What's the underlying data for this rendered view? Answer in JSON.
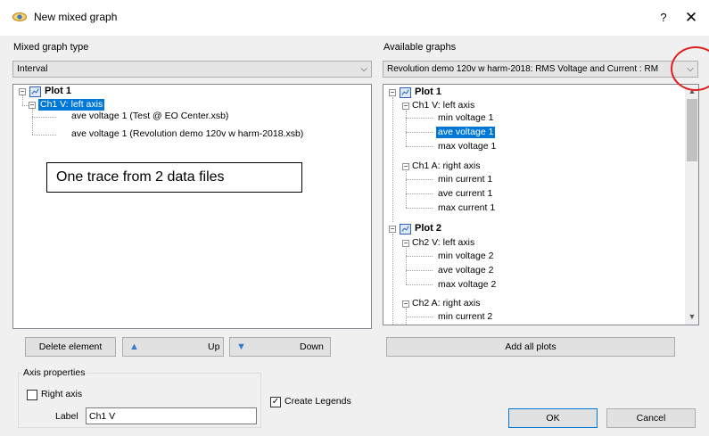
{
  "window": {
    "title": "New mixed graph",
    "help_label": "?",
    "close_label": "✕"
  },
  "left": {
    "type_label": "Mixed graph type",
    "type_value": "Interval",
    "tree": {
      "plot": "Plot 1",
      "axis": "Ch1 V: left axis",
      "items": [
        "ave voltage 1  (Test @ EO Center.xsb)",
        "ave voltage 1  (Revolution demo 120v w harm-2018.xsb)"
      ]
    },
    "annotation": "One trace from 2  data files"
  },
  "right": {
    "available_label": "Available graphs",
    "available_value": "Revolution demo 120v w harm-2018: RMS Voltage and Current : RM",
    "tree": {
      "plot1": "Plot 1",
      "plot1_axis1": "Ch1 V: left axis",
      "plot1_axis1_items": [
        "min voltage 1",
        "ave voltage 1",
        "max voltage 1"
      ],
      "plot1_axis2": "Ch1 A: right axis",
      "plot1_axis2_items": [
        "min current 1",
        "ave current 1",
        "max current 1"
      ],
      "plot2": "Plot 2",
      "plot2_axis1": "Ch2 V: left axis",
      "plot2_axis1_items": [
        "min voltage 2",
        "ave voltage 2",
        "max voltage 2"
      ],
      "plot2_axis2": "Ch2 A: right axis",
      "plot2_axis2_items": [
        "min current 2"
      ]
    }
  },
  "buttons": {
    "delete": "Delete element",
    "up": "Up",
    "down": "Down",
    "add_all": "Add all plots",
    "ok": "OK",
    "cancel": "Cancel"
  },
  "axis_props": {
    "group_label": "Axis properties",
    "right_axis_label": "Right axis",
    "right_axis_checked": false,
    "label_caption": "Label",
    "label_value": "Ch1 V"
  },
  "legends": {
    "label": "Create Legends",
    "checked": true
  },
  "colors": {
    "selection": "#0078d7",
    "annotation_circle": "#e02020"
  }
}
